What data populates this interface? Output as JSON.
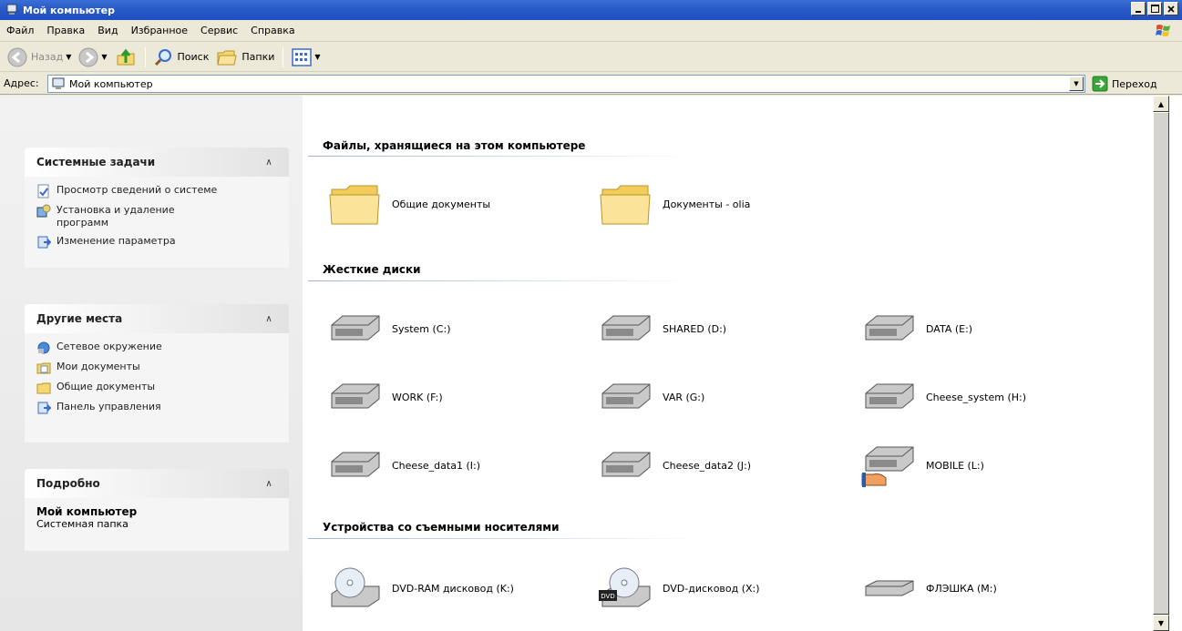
{
  "window": {
    "title": "Мой компьютер"
  },
  "menu": [
    "Файл",
    "Правка",
    "Вид",
    "Избранное",
    "Сервис",
    "Справка"
  ],
  "toolbar": {
    "back": "Назад",
    "search": "Поиск",
    "folders": "Папки"
  },
  "address": {
    "label": "Адрес:",
    "value": "Мой компьютер",
    "go": "Переход"
  },
  "taskpane": {
    "system": {
      "title": "Системные задачи",
      "items": [
        "Просмотр сведений о системе",
        "Установка и удаление программ",
        "Изменение параметра"
      ]
    },
    "places": {
      "title": "Другие места",
      "items": [
        "Сетевое окружение",
        "Мои документы",
        "Общие документы",
        "Панель управления"
      ]
    },
    "details": {
      "title": "Подробно",
      "name": "Мой компьютер",
      "type": "Системная папка"
    }
  },
  "groups": {
    "files": {
      "title": "Файлы, хранящиеся на этом компьютере",
      "items": [
        "Общие документы",
        "Документы - olia"
      ]
    },
    "drives": {
      "title": "Жесткие диски",
      "items": [
        "System (C:)",
        "SHARED (D:)",
        "DATA (E:)",
        "WORK (F:)",
        "VAR (G:)",
        "Cheese_system (H:)",
        "Cheese_data1 (I:)",
        "Cheese_data2 (J:)",
        "MOBILE (L:)"
      ]
    },
    "removable": {
      "title": "Устройства со съемными носителями",
      "items": [
        "DVD-RAM дисковод (K:)",
        "DVD-дисковод (X:)",
        "ФЛЭШКА (M:)"
      ]
    }
  },
  "icons": {
    "folder": "folder-icon",
    "hdd": "hard-drive-icon",
    "dvd": "dvd-drive-icon",
    "flash": "flash-drive-icon"
  },
  "colors": {
    "titlebar": "#2a5cc8",
    "taskpane_bg": "#e8e8e8",
    "folder": "#f5d774"
  }
}
